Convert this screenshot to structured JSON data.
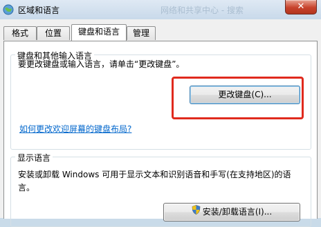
{
  "window": {
    "title": "区域和语言",
    "ghost_title": "网络和共享中心 - 搜索",
    "close_label": "✕"
  },
  "tabs": [
    {
      "label": "格式"
    },
    {
      "label": "位置"
    },
    {
      "label": "键盘和语言",
      "active": true
    },
    {
      "label": "管理"
    }
  ],
  "keyboards": {
    "group_title": "键盘和其他输入语言",
    "description": "要更改键盘或输入语言，请单击“更改键盘”。",
    "change_button": "更改键盘(C)...",
    "welcome_link": "如何更改欢迎屏幕的键盘布局?"
  },
  "display_language": {
    "group_title": "显示语言",
    "description_line1": "安装或卸载 Windows 可用于显示文本和识别语音和手写(在支持地区)的语",
    "description_line2": "言。",
    "install_button": "安装/卸载语言(I)..."
  },
  "colors": {
    "highlight": "#e02a1d",
    "link": "#0066cc"
  }
}
